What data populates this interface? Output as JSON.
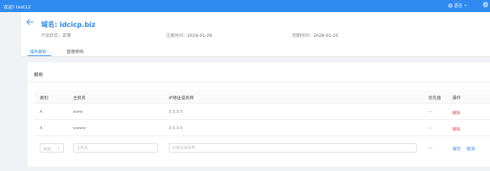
{
  "topbar": {
    "welcome": "欢迎! test12",
    "language": "语言",
    "colors": {
      "bar": "#2f8af0"
    }
  },
  "domain": {
    "title": "域名: idcicp.biz",
    "status_label": "产品状态：",
    "status_value": "正常",
    "registered_label": "注册时间：",
    "registered_value": "2016-01-26",
    "expires_label": "到期时间：",
    "expires_value": "2026-01-25"
  },
  "tabs": [
    {
      "label": "域名解析",
      "active": true
    },
    {
      "label": "管理密码",
      "active": false
    }
  ],
  "section": {
    "title": "解析"
  },
  "table": {
    "headers": {
      "type": "类别",
      "host": "主机名",
      "ip": "IP地址或名称",
      "priority": "优先级",
      "op": "操作"
    },
    "rows": [
      {
        "type": "A",
        "host": "www",
        "ip": "3.3.3.3",
        "priority": "---",
        "action": "删除"
      },
      {
        "type": "A",
        "host": "wwww",
        "ip": "3.3.3.3",
        "priority": "---",
        "action": "删除"
      }
    ]
  },
  "edit": {
    "type_placeholder": "类别",
    "host_placeholder": "主机名",
    "ip_placeholder": "IP地址或名称",
    "priority": "---",
    "save": "保存",
    "cancel": "取消"
  },
  "icons": {
    "back": "arrow-left-icon",
    "globe": "globe-icon",
    "settings": "gear-icon",
    "dropdown": "chevron-down-icon"
  }
}
